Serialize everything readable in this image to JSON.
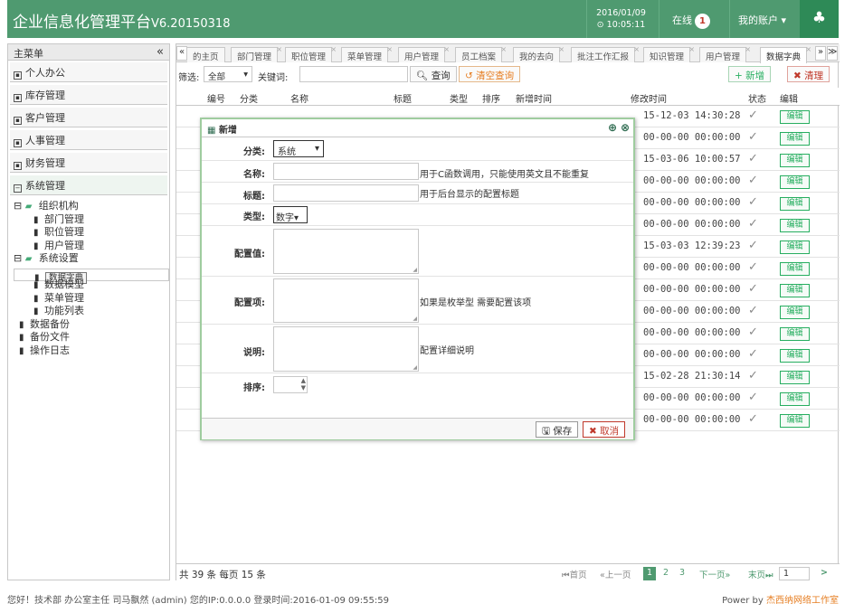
{
  "header": {
    "title": "企业信息化管理平台",
    "version": "V6.20150318",
    "date": "2016/01/09",
    "time": "10:05:11",
    "online_label": "在线",
    "online_count": "1",
    "account_label": "我的账户"
  },
  "sidebar": {
    "title": "主菜单",
    "collapse": "«",
    "sections": [
      "个人办公",
      "库存管理",
      "客户管理",
      "人事管理",
      "财务管理",
      "系统管理"
    ],
    "tree": [
      "组织机构",
      "部门管理",
      "职位管理",
      "用户管理",
      "系统设置",
      "数据字典",
      "数据模型",
      "菜单管理",
      "功能列表",
      "数据备份",
      "备份文件",
      "操作日志"
    ]
  },
  "tabs": {
    "items": [
      "的主页",
      "部门管理",
      "职位管理",
      "菜单管理",
      "用户管理",
      "员工档案",
      "我的去向",
      "批注工作汇报",
      "知识管理",
      "用户管理",
      "数据字典"
    ],
    "nav_left": "«",
    "nav_right": "»",
    "nav_down": "≫"
  },
  "toolbar": {
    "filter_label": "筛选:",
    "filter_value": "全部",
    "keyword_label": "关键词:",
    "query": "查询",
    "clear": "清空查询",
    "add": "新增",
    "cleanup": "清理"
  },
  "grid": {
    "headers": [
      "编号",
      "分类",
      "名称",
      "标题",
      "类型",
      "排序",
      "新增时间",
      "修改时间",
      "状态",
      "编辑"
    ],
    "times": [
      "15-12-03 14:30:28",
      "00-00-00 00:00:00",
      "15-03-06 10:00:57",
      "00-00-00 00:00:00",
      "00-00-00 00:00:00",
      "00-00-00 00:00:00",
      "15-03-03 12:39:23",
      "00-00-00 00:00:00",
      "00-00-00 00:00:00",
      "00-00-00 00:00:00",
      "00-00-00 00:00:00",
      "00-00-00 00:00:00",
      "15-02-28 21:30:14",
      "00-00-00 00:00:00",
      "00-00-00 00:00:00"
    ],
    "edit_label": "编辑"
  },
  "pager": {
    "summary": "共 39 条 每页 15 条",
    "first": "首页",
    "prev": "上一页",
    "pages": [
      "1",
      "2",
      "3"
    ],
    "next": "下一页",
    "last": "末页",
    "jump": "1",
    "go": ">"
  },
  "status": {
    "left": "您好！技术部 办公室主任 司马飘然 (admin) 您的IP:0.0.0.0 登录时间:2016-01-09 09:55:59",
    "power_prefix": "Power by ",
    "power_link": "杰西纳网络工作室"
  },
  "dialog": {
    "title": "新增",
    "category_label": "分类:",
    "category_value": "系统",
    "name_label": "名称:",
    "name_hint": "用于C函数调用，只能使用英文且不能重复",
    "title_label": "标题:",
    "title_hint": "用于后台显示的配置标题",
    "type_label": "类型:",
    "type_value": "数字",
    "value_label": "配置值:",
    "options_label": "配置项:",
    "options_hint": "如果是枚举型 需要配置该项",
    "desc_label": "说明:",
    "desc_hint": "配置详细说明",
    "sort_label": "排序:",
    "save": "保存",
    "cancel": "取消"
  }
}
